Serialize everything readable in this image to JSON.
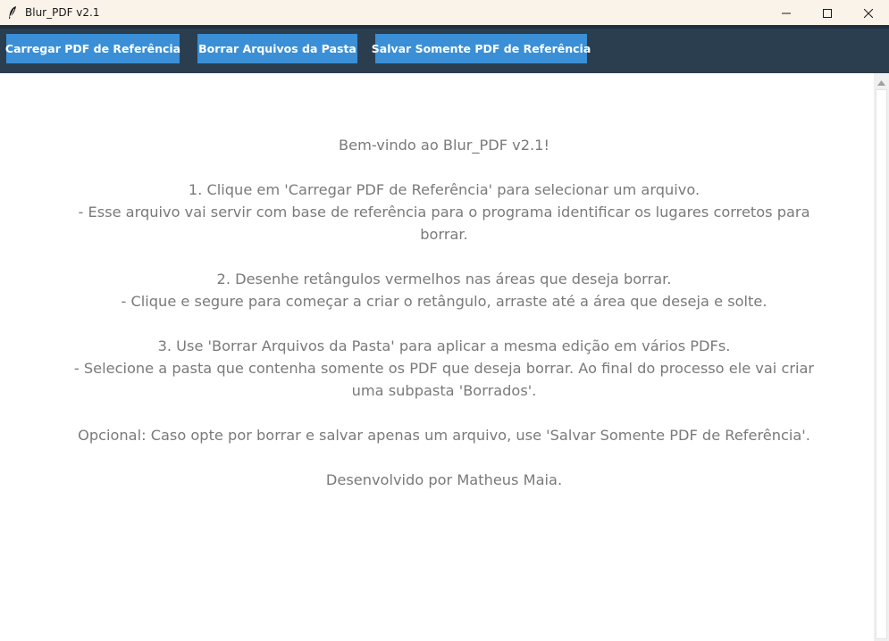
{
  "window": {
    "title": "Blur_PDF v2.1",
    "controls": {
      "minimize_icon": "minimize-icon",
      "maximize_icon": "maximize-icon",
      "close_icon": "close-icon"
    }
  },
  "toolbar": {
    "load_reference_label": "Carregar PDF de Referência",
    "blur_folder_label": "Borrar Arquivos da Pasta",
    "save_reference_label": "Salvar Somente PDF de Referência"
  },
  "colors": {
    "toolbar_bg": "#2b3e50",
    "button_bg": "#3a8fd6",
    "text_gray": "#7a7a7a",
    "titlebar_bg": "#faf3ea"
  },
  "instructions": {
    "lines": [
      "Bem-vindo ao Blur_PDF v2.1!",
      "",
      "1. Clique em 'Carregar PDF de Referência' para selecionar um arquivo.",
      "- Esse arquivo vai servir com base de referência para o programa identificar os lugares corretos para",
      "borrar.",
      "",
      "2. Desenhe retângulos vermelhos nas áreas que deseja borrar.",
      "- Clique e segure para começar a criar o retângulo, arraste até a área que deseja e solte.",
      "",
      "3. Use 'Borrar Arquivos da Pasta' para aplicar a mesma edição em vários PDFs.",
      "- Selecione a pasta que contenha somente os PDF que deseja borrar. Ao final do processo ele vai criar",
      "uma subpasta 'Borrados'.",
      "",
      "Opcional: Caso opte por borrar e salvar apenas um arquivo, use 'Salvar Somente PDF de Referência'.",
      "",
      "Desenvolvido por Matheus Maia."
    ]
  }
}
